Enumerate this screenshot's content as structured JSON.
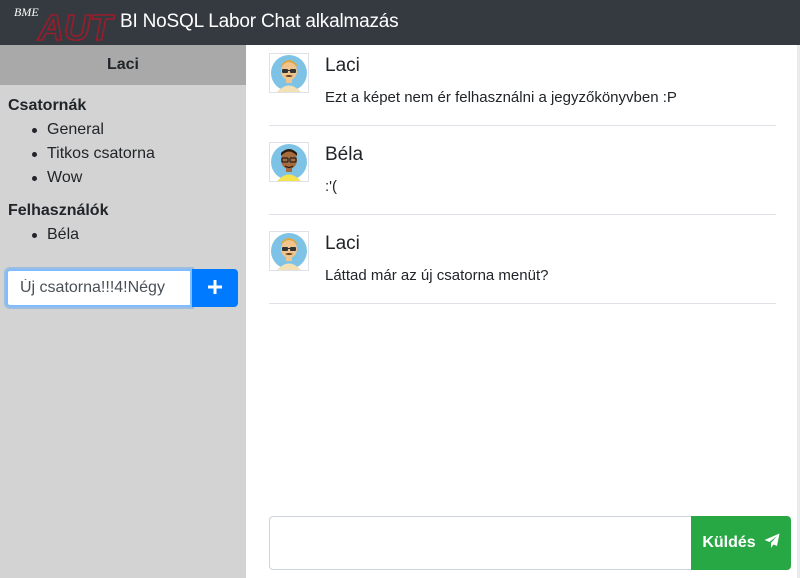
{
  "header": {
    "title": "BI NoSQL Labor Chat alkalmazás",
    "logo_small_text": "BME",
    "logo_text": "AUT",
    "logo_icon": "bme-aut-logo",
    "color": "#343a40"
  },
  "sidebar": {
    "current_user": "Laci",
    "channels_title": "Csatornák",
    "channels": [
      {
        "label": "General"
      },
      {
        "label": "Titkos csatorna"
      },
      {
        "label": "Wow"
      }
    ],
    "users_title": "Felhasználók",
    "users": [
      {
        "label": "Béla"
      }
    ],
    "new_channel_value": "Új csatorna!!!4!Négy",
    "add_icon": "plus-icon",
    "add_color": "#007bff"
  },
  "messages": [
    {
      "author": "Laci",
      "text": "Ezt a képet nem ér felhasználni a jegyzőkönyvben :P",
      "avatar_icon": "avatar-laci-icon"
    },
    {
      "author": "Béla",
      "text": ":'(",
      "avatar_icon": "avatar-bela-icon"
    },
    {
      "author": "Laci",
      "text": "Láttad már az új csatorna menüt?",
      "avatar_icon": "avatar-laci-icon"
    }
  ],
  "compose": {
    "value": "",
    "send_label": "Küldés",
    "send_icon": "paper-plane-icon",
    "send_color": "#28a745"
  }
}
